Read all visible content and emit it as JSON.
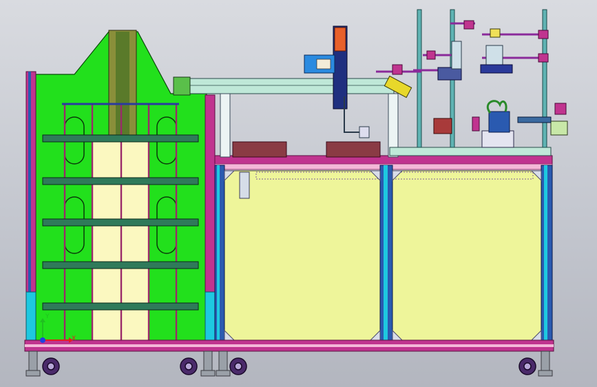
{
  "triad": {
    "x_label": "X",
    "y_label": "Y"
  },
  "colors": {
    "background": "#c8cad1",
    "frame_magenta": "#c0348f",
    "panel_green": "#22e01c",
    "panel_yellow": "#fbf8c0",
    "shelf_green": "#2f7a5a",
    "cabinet_fill": "#eef59a",
    "profile_blue": "#2a5ab0",
    "profile_cyan": "#1ec8e0",
    "tray_brown": "#8a3b44",
    "pole_teal": "#5fb3b3",
    "caster": "#4a2a6a"
  },
  "components": {
    "left_tower": "magazine-loader",
    "center_gantry": "gantry-module",
    "right_cabinet": "machine-base-cabinet",
    "right_top": "camera-inspection-station"
  }
}
